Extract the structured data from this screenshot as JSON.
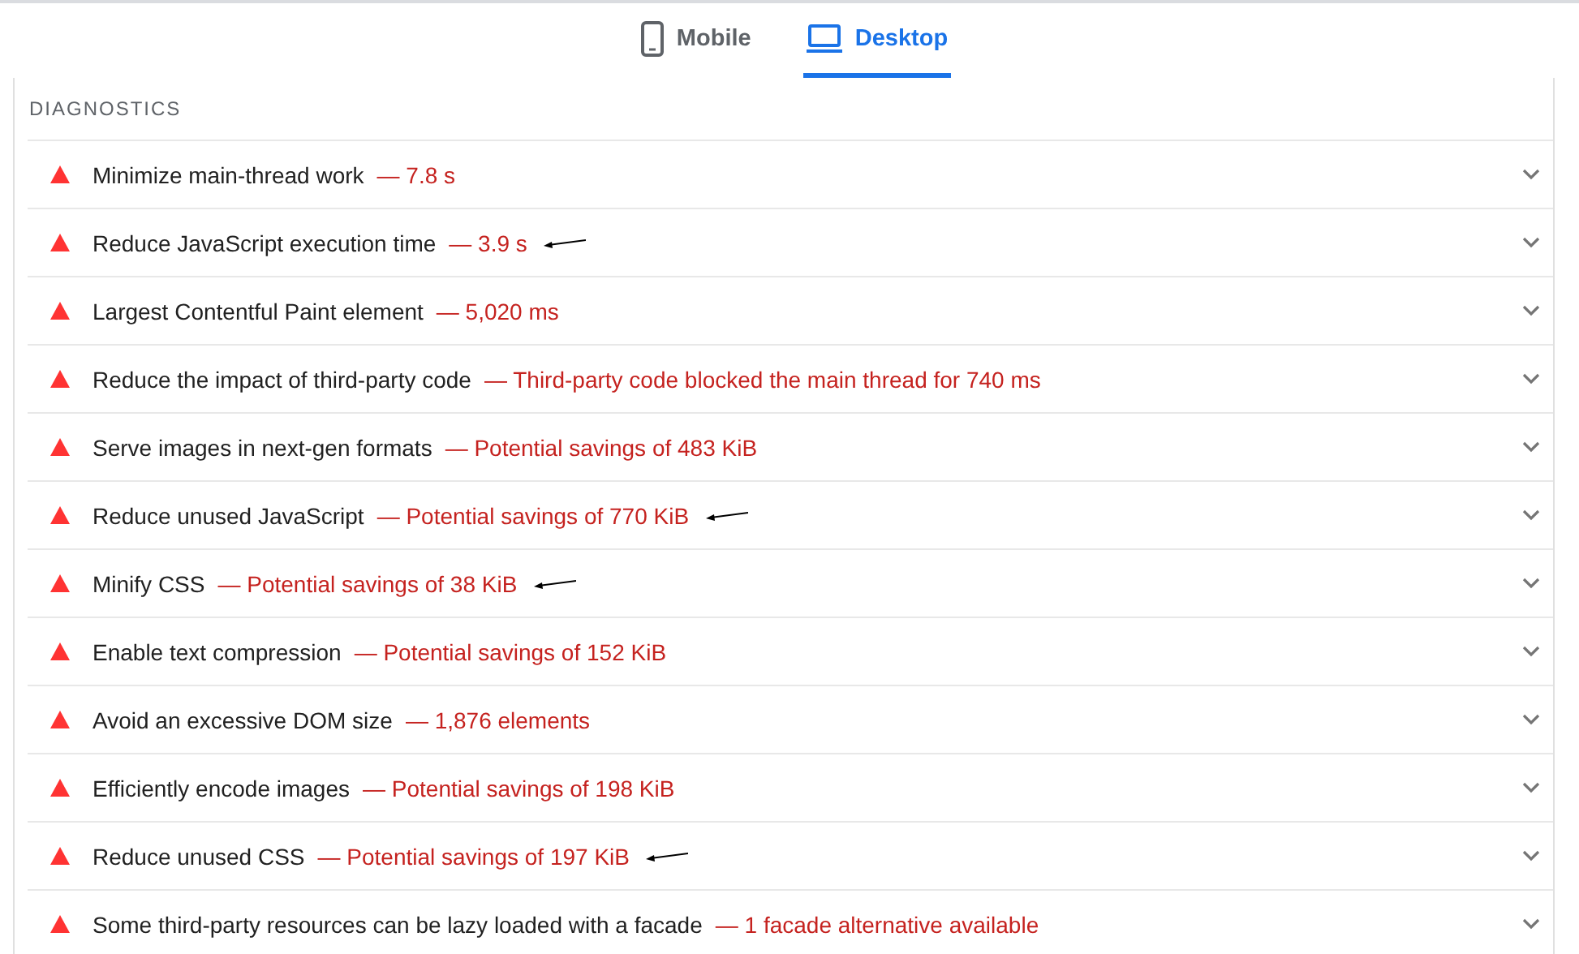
{
  "tabs": [
    {
      "label": "Mobile",
      "kind": "phone",
      "selected": false
    },
    {
      "label": "Desktop",
      "kind": "laptop",
      "selected": true
    }
  ],
  "section": {
    "title": "DIAGNOSTICS"
  },
  "audits": [
    {
      "title": "Minimize main-thread work",
      "value": "— 7.8 s",
      "annotated": false
    },
    {
      "title": "Reduce JavaScript execution time",
      "value": "— 3.9 s",
      "annotated": true
    },
    {
      "title": "Largest Contentful Paint element",
      "value": "— 5,020 ms",
      "annotated": false
    },
    {
      "title": "Reduce the impact of third-party code",
      "value": "— Third-party code blocked the main thread for 740 ms",
      "annotated": false
    },
    {
      "title": "Serve images in next-gen formats",
      "value": "— Potential savings of 483 KiB",
      "annotated": false
    },
    {
      "title": "Reduce unused JavaScript",
      "value": "— Potential savings of 770 KiB",
      "annotated": true
    },
    {
      "title": "Minify CSS",
      "value": "— Potential savings of 38 KiB",
      "annotated": true
    },
    {
      "title": "Enable text compression",
      "value": "— Potential savings of 152 KiB",
      "annotated": false
    },
    {
      "title": "Avoid an excessive DOM size",
      "value": "— 1,876 elements",
      "annotated": false
    },
    {
      "title": "Efficiently encode images",
      "value": "— Potential savings of 198 KiB",
      "annotated": false
    },
    {
      "title": "Reduce unused CSS",
      "value": "— Potential savings of 197 KiB",
      "annotated": true
    },
    {
      "title": "Some third-party resources can be lazy loaded with a facade",
      "value": "— 1 facade alternative available",
      "annotated": false
    }
  ]
}
